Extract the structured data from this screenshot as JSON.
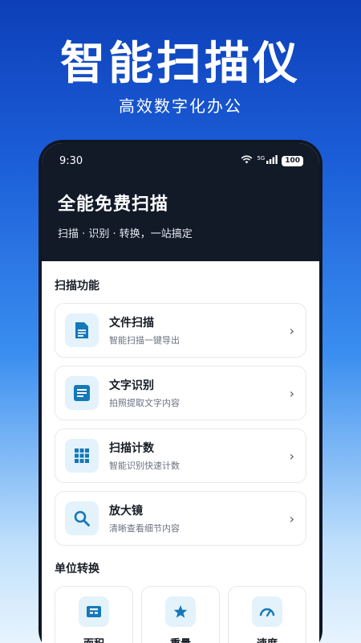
{
  "hero": {
    "title": "智能扫描仪",
    "subtitle": "高效数字化办公"
  },
  "status_bar": {
    "time": "9:30",
    "network": "5G",
    "battery": "100"
  },
  "banner": {
    "title": "全能免费扫描",
    "subtitle": "扫描 · 识别 · 转换，一站搞定"
  },
  "scan_section": {
    "title": "扫描功能",
    "items": [
      {
        "name": "文件扫描",
        "desc": "智能扫描一键导出",
        "icon": "document-icon"
      },
      {
        "name": "文字识别",
        "desc": "拍照提取文字内容",
        "icon": "text-recognition-icon"
      },
      {
        "name": "扫描计数",
        "desc": "智能识别快速计数",
        "icon": "grid-count-icon"
      },
      {
        "name": "放大镜",
        "desc": "清晰查看细节内容",
        "icon": "magnifier-icon"
      }
    ]
  },
  "unit_section": {
    "title": "单位转换",
    "items": [
      {
        "label": "面积",
        "icon": "area-icon"
      },
      {
        "label": "重量",
        "icon": "star-weight-icon"
      },
      {
        "label": "速度",
        "icon": "speedometer-icon"
      }
    ]
  },
  "colors": {
    "accent": "#1479b8",
    "icon_bg": "#e3f2fb",
    "dark_header": "#121a28"
  }
}
